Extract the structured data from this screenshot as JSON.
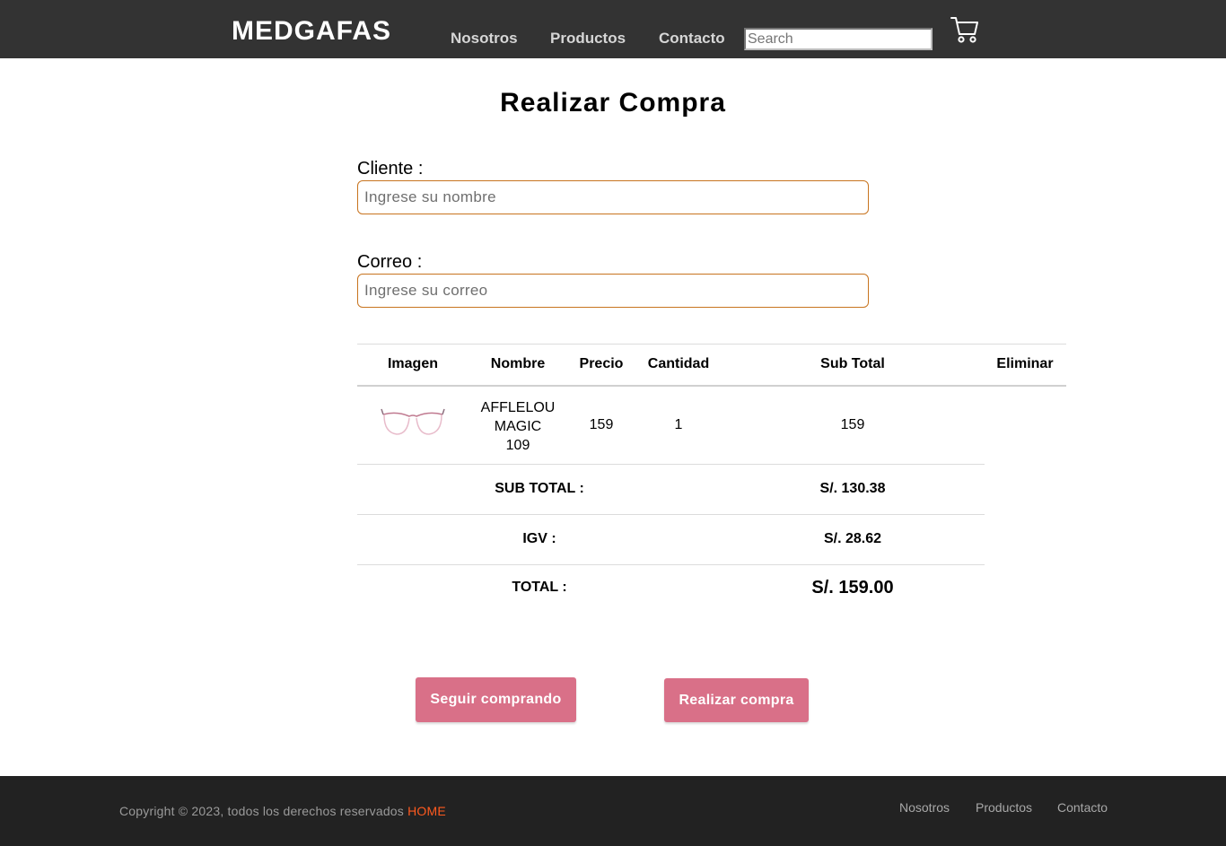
{
  "header": {
    "brand": "MEDGAFAS",
    "nav": [
      "Nosotros",
      "Productos",
      "Contacto"
    ],
    "search_placeholder": "Search"
  },
  "page": {
    "title": "Realizar Compra"
  },
  "form": {
    "cliente_label": "Cliente :",
    "cliente_placeholder": "Ingrese su nombre",
    "correo_label": "Correo :",
    "correo_placeholder": "Ingrese su correo"
  },
  "table": {
    "headers": [
      "Imagen",
      "Nombre",
      "Precio",
      "Cantidad",
      "Sub Total",
      "Eliminar"
    ],
    "rows": [
      {
        "name_lines": [
          "AFFLELOU",
          "MAGIC",
          "109"
        ],
        "precio": "159",
        "cantidad": "1",
        "subtotal": "159",
        "image_icon": "eyeglasses-icon"
      }
    ]
  },
  "summary": {
    "subtotal_label": "SUB TOTAL :",
    "subtotal_value": "S/. 130.38",
    "igv_label": "IGV :",
    "igv_value": "S/. 28.62",
    "total_label": "TOTAL :",
    "total_value": "S/. 159.00"
  },
  "buttons": {
    "seguir": "Seguir comprando",
    "realizar": "Realizar compra"
  },
  "footer": {
    "copyright": "Copyright © 2023, todos los derechos reservados",
    "home": "HOME",
    "links": [
      "Nosotros",
      "Productos",
      "Contacto"
    ]
  },
  "colors": {
    "header_bg": "#333333",
    "footer_bg": "#222222",
    "button_bg": "#d97088",
    "input_border": "#c8741f",
    "home_link": "#ff5a1f"
  }
}
